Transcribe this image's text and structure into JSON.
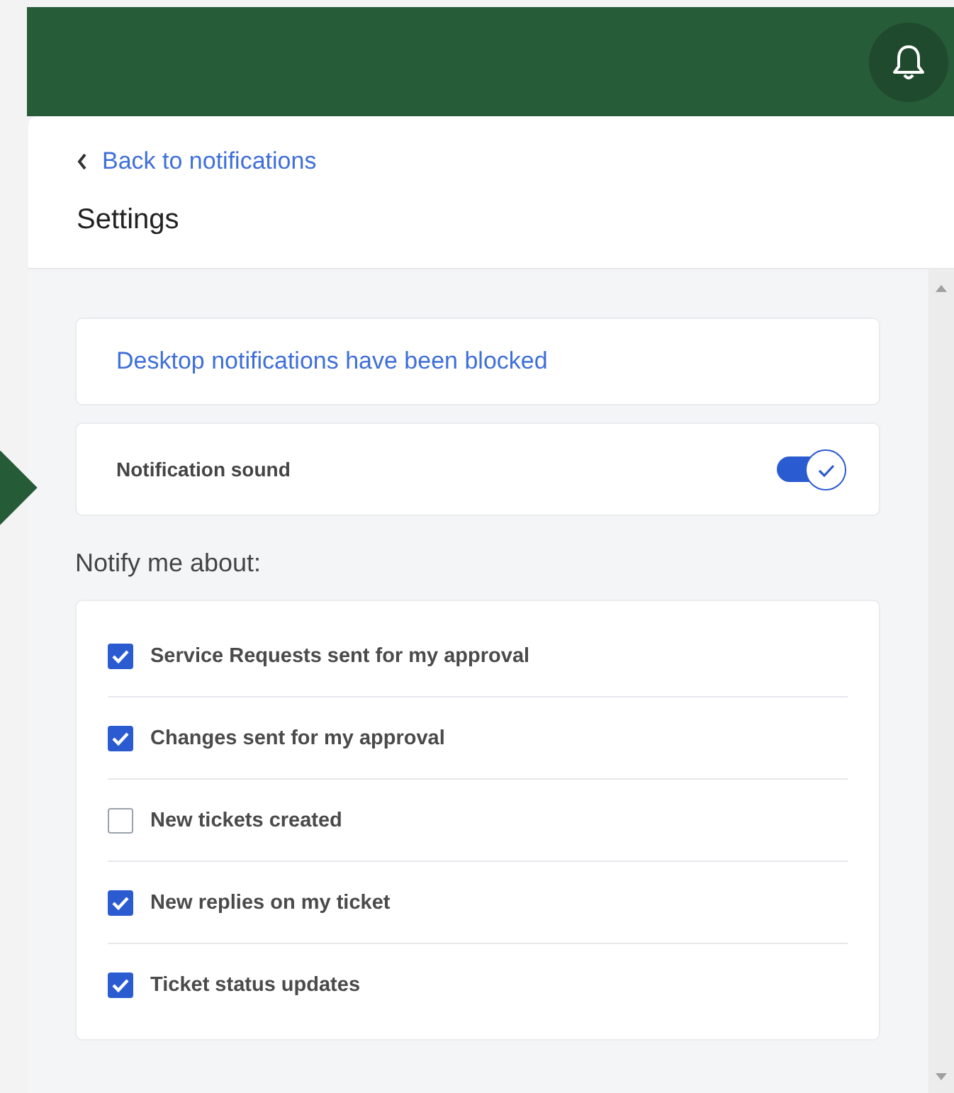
{
  "back_link": "Back to notifications",
  "title": "Settings",
  "blocked_notice": "Desktop notifications have been blocked",
  "sound": {
    "label": "Notification sound",
    "on": true
  },
  "notify_heading": "Notify me about:",
  "options": [
    {
      "label": "Service Requests sent for my approval",
      "checked": true
    },
    {
      "label": "Changes sent for my approval",
      "checked": true
    },
    {
      "label": "New tickets created",
      "checked": false
    },
    {
      "label": "New replies on my ticket",
      "checked": true
    },
    {
      "label": "Ticket status updates",
      "checked": true
    }
  ]
}
